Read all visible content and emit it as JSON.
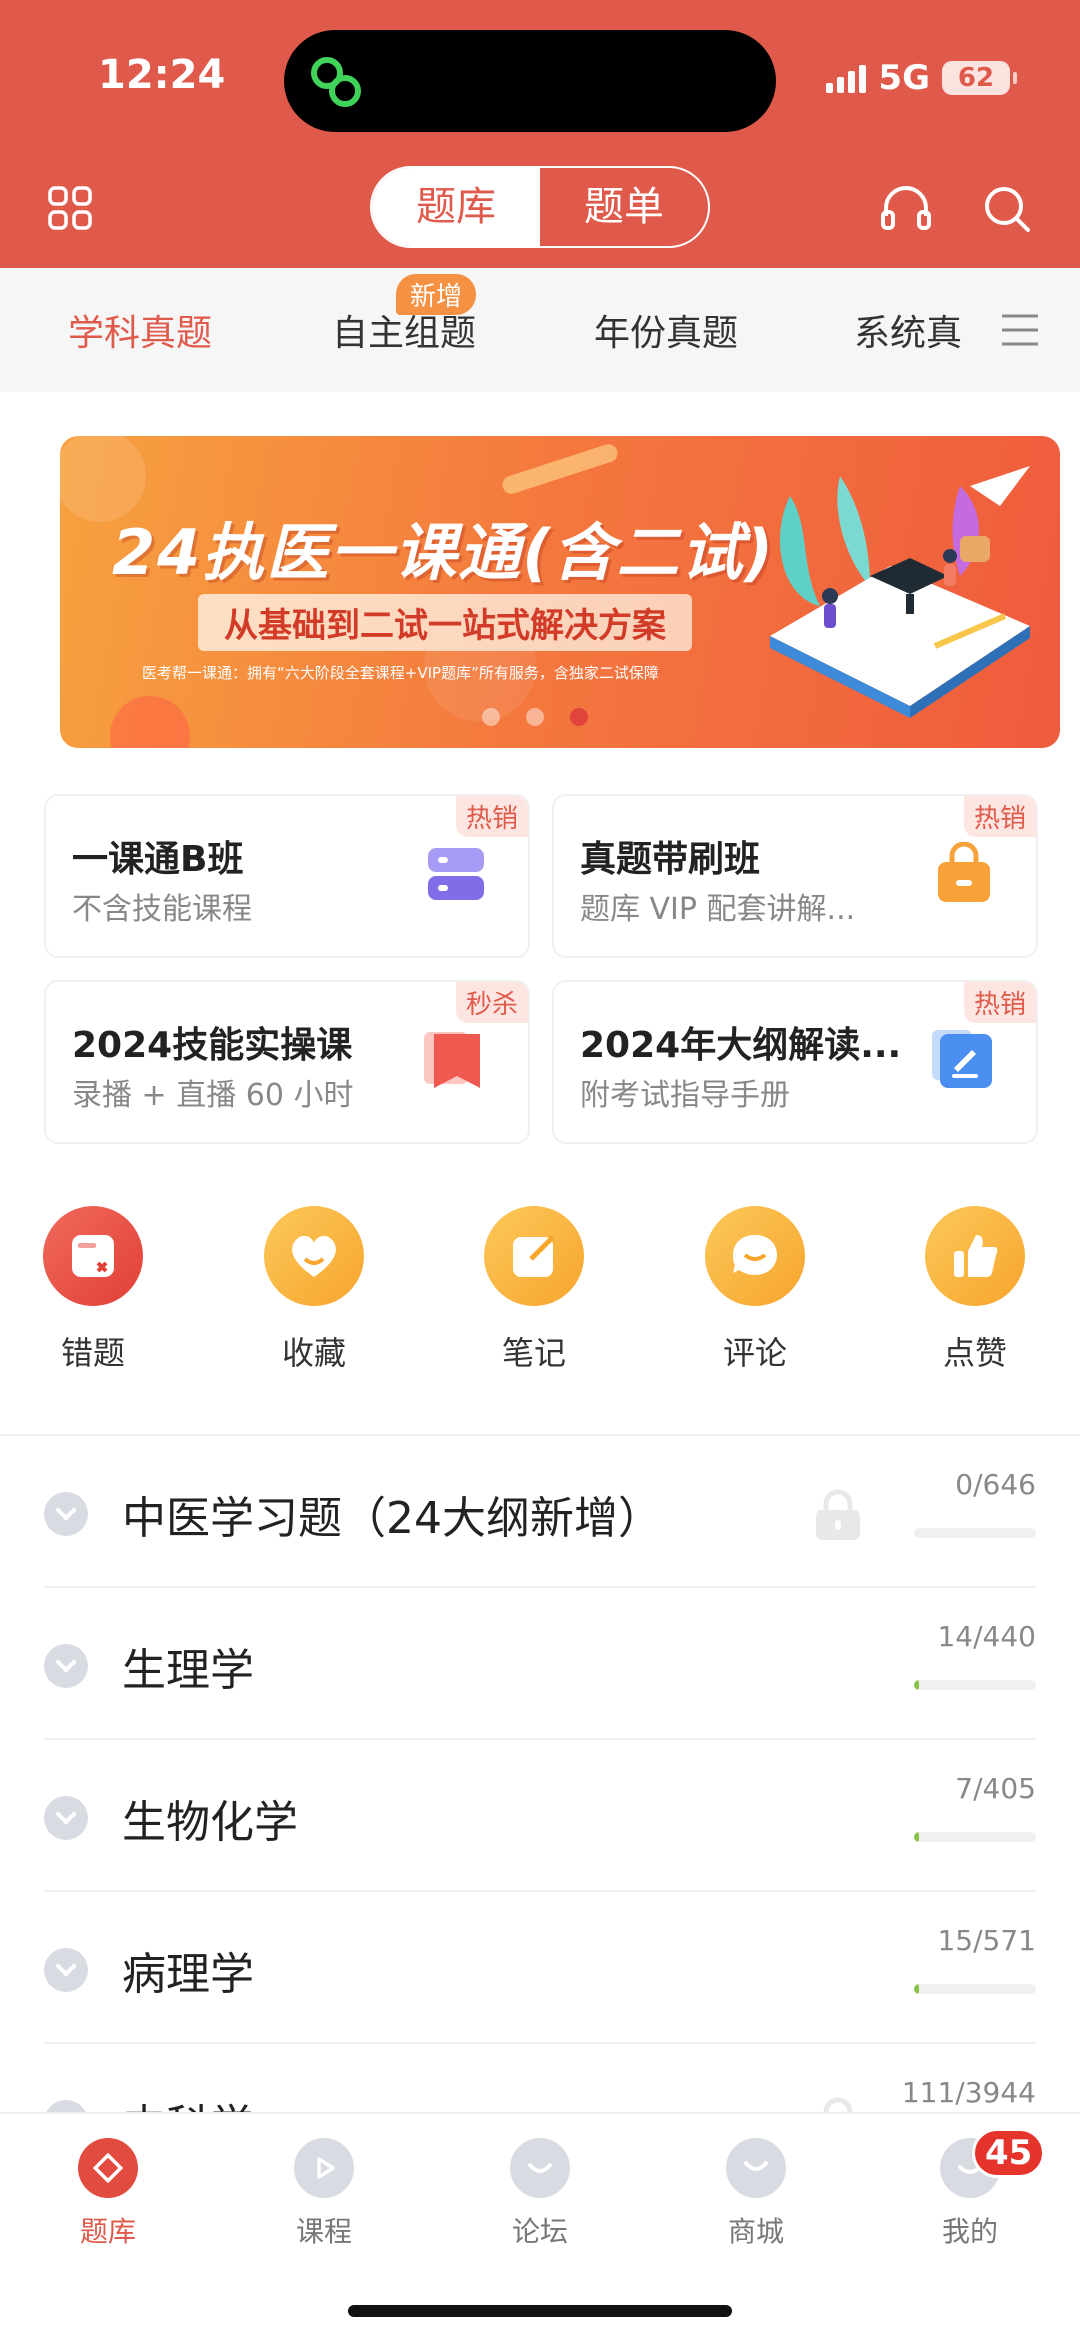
{
  "status_bar": {
    "time": "12:24",
    "network": "5G",
    "battery": "62"
  },
  "header": {
    "segments": [
      "题库",
      "题单"
    ],
    "active_segment": 0
  },
  "category_tabs": {
    "items": [
      "学科真题",
      "自主组题",
      "年份真题",
      "系统真"
    ],
    "active": 0,
    "new_badge": "新增"
  },
  "banner": {
    "title": "24执医一课通(含二试)",
    "subtitle": "从基础到二试一站式解决方案",
    "description": "医考帮一课通：拥有“六大阶段全套课程+VIP题库”所有服务，含独家二试保障",
    "dot_count": 3,
    "active_dot": 2
  },
  "course_cards": [
    {
      "title": "一课通B班",
      "subtitle": "不含技能课程",
      "badge": "热销",
      "icon": "layers-icon",
      "color": "#8a7cf0"
    },
    {
      "title": "真题带刷班",
      "subtitle": "题库 VIP 配套讲解...",
      "badge": "热销",
      "icon": "bag-icon",
      "color": "#f9a23a"
    },
    {
      "title": "2024技能实操课",
      "subtitle": "录播 + 直播 60 小时",
      "badge": "秒杀",
      "icon": "bookmark-icon",
      "color": "#ee5a4f"
    },
    {
      "title": "2024年大纲解读...",
      "subtitle": "附考试指导手册",
      "badge": "热销",
      "icon": "edit-icon",
      "color": "#4a8ef0"
    }
  ],
  "quick_actions": [
    {
      "label": "错题",
      "icon": "wrong-question-icon"
    },
    {
      "label": "收藏",
      "icon": "heart-icon"
    },
    {
      "label": "笔记",
      "icon": "note-icon"
    },
    {
      "label": "评论",
      "icon": "comment-icon"
    },
    {
      "label": "点赞",
      "icon": "thumbs-up-icon"
    }
  ],
  "subjects": [
    {
      "name": "中医学习题（24大纲新增）",
      "count": "0/646",
      "done": 0,
      "total": 646,
      "locked": true
    },
    {
      "name": "生理学",
      "count": "14/440",
      "done": 14,
      "total": 440,
      "locked": false
    },
    {
      "name": "生物化学",
      "count": "7/405",
      "done": 7,
      "total": 405,
      "locked": false
    },
    {
      "name": "病理学",
      "count": "15/571",
      "done": 15,
      "total": 571,
      "locked": false
    },
    {
      "name": "内科学",
      "count": "111/3944",
      "done": 111,
      "total": 3944,
      "locked": true
    }
  ],
  "bottom_nav": {
    "items": [
      {
        "label": "题库",
        "icon": "question-bank-icon"
      },
      {
        "label": "课程",
        "icon": "play-icon"
      },
      {
        "label": "论坛",
        "icon": "forum-icon"
      },
      {
        "label": "商城",
        "icon": "shop-icon"
      },
      {
        "label": "我的",
        "icon": "profile-icon"
      }
    ],
    "active": 0,
    "profile_badge": "45"
  },
  "colors": {
    "brand_red": "#e05a4c",
    "accent_orange": "#f49143",
    "progress_green": "#8bc34a"
  }
}
